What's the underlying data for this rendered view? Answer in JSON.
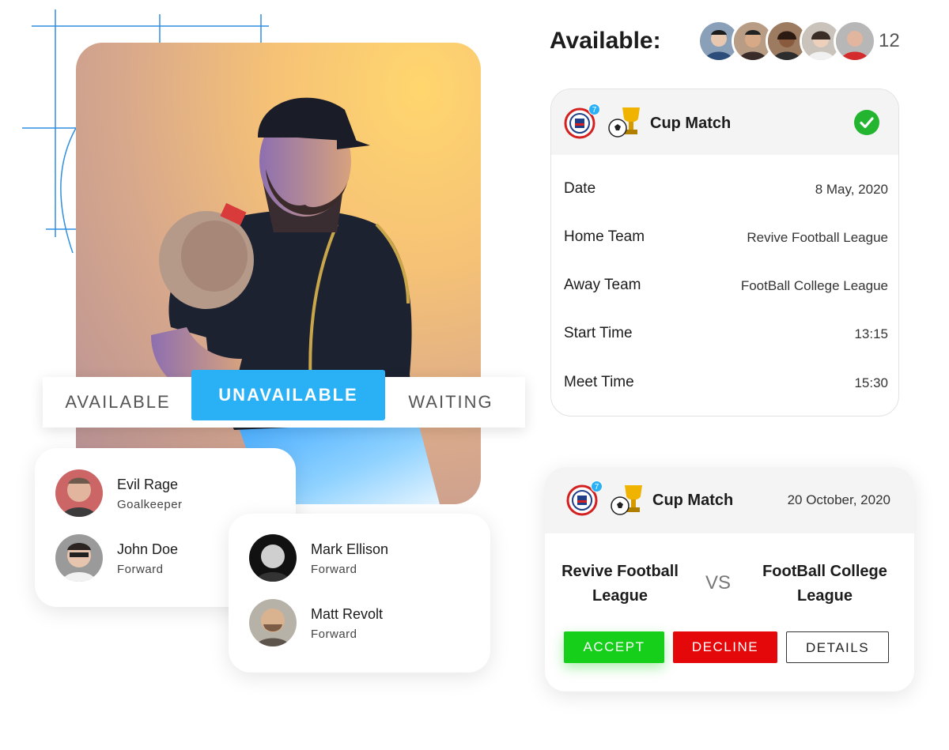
{
  "availability_toggle": {
    "options": [
      "AVAILABLE",
      "UNAVAILABLE",
      "WAITING"
    ],
    "selected": "UNAVAILABLE"
  },
  "player_cards": [
    {
      "players": [
        {
          "name": "Evil Rage",
          "position": "Goalkeeper"
        },
        {
          "name": "John Doe",
          "position": "Forward"
        }
      ]
    },
    {
      "players": [
        {
          "name": "Mark Ellison",
          "position": "Forward"
        },
        {
          "name": "Matt Revolt",
          "position": "Forward"
        }
      ]
    }
  ],
  "available": {
    "title": "Available:",
    "count": "12"
  },
  "match_card": {
    "badge_count": "7",
    "title": "Cup Match",
    "rows": [
      {
        "label": "Date",
        "value": "8 May, 2020"
      },
      {
        "label": "Home Team",
        "value": "Revive Football League"
      },
      {
        "label": "Away Team",
        "value": "FootBall College League"
      },
      {
        "label": "Start Time",
        "value": "13:15"
      },
      {
        "label": "Meet Time",
        "value": "15:30"
      }
    ]
  },
  "invite_card": {
    "badge_count": "7",
    "title": "Cup Match",
    "date": "20 October, 2020",
    "home_team": "Revive Football League",
    "vs": "VS",
    "away_team": "FootBall College League",
    "accept_label": "ACCEPT",
    "decline_label": "DECLINE",
    "details_label": "DETAILS"
  },
  "colors": {
    "accent_blue": "#2ab0f5",
    "accept_green": "#16cf1a",
    "decline_red": "#e4080a",
    "check_green": "#23b430"
  },
  "icons": [
    "team-crest-icon",
    "trophy-ball-icon",
    "check-icon"
  ]
}
